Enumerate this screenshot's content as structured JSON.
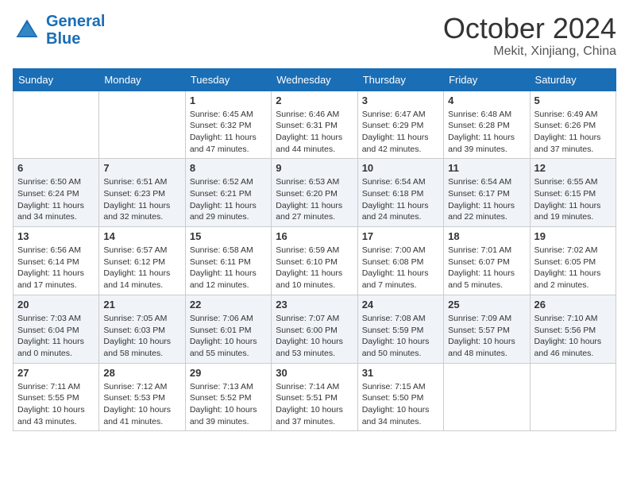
{
  "header": {
    "logo_line1": "General",
    "logo_line2": "Blue",
    "month": "October 2024",
    "location": "Mekit, Xinjiang, China"
  },
  "days_of_week": [
    "Sunday",
    "Monday",
    "Tuesday",
    "Wednesday",
    "Thursday",
    "Friday",
    "Saturday"
  ],
  "weeks": [
    [
      {
        "day": "",
        "info": ""
      },
      {
        "day": "",
        "info": ""
      },
      {
        "day": "1",
        "info": "Sunrise: 6:45 AM\nSunset: 6:32 PM\nDaylight: 11 hours and 47 minutes."
      },
      {
        "day": "2",
        "info": "Sunrise: 6:46 AM\nSunset: 6:31 PM\nDaylight: 11 hours and 44 minutes."
      },
      {
        "day": "3",
        "info": "Sunrise: 6:47 AM\nSunset: 6:29 PM\nDaylight: 11 hours and 42 minutes."
      },
      {
        "day": "4",
        "info": "Sunrise: 6:48 AM\nSunset: 6:28 PM\nDaylight: 11 hours and 39 minutes."
      },
      {
        "day": "5",
        "info": "Sunrise: 6:49 AM\nSunset: 6:26 PM\nDaylight: 11 hours and 37 minutes."
      }
    ],
    [
      {
        "day": "6",
        "info": "Sunrise: 6:50 AM\nSunset: 6:24 PM\nDaylight: 11 hours and 34 minutes."
      },
      {
        "day": "7",
        "info": "Sunrise: 6:51 AM\nSunset: 6:23 PM\nDaylight: 11 hours and 32 minutes."
      },
      {
        "day": "8",
        "info": "Sunrise: 6:52 AM\nSunset: 6:21 PM\nDaylight: 11 hours and 29 minutes."
      },
      {
        "day": "9",
        "info": "Sunrise: 6:53 AM\nSunset: 6:20 PM\nDaylight: 11 hours and 27 minutes."
      },
      {
        "day": "10",
        "info": "Sunrise: 6:54 AM\nSunset: 6:18 PM\nDaylight: 11 hours and 24 minutes."
      },
      {
        "day": "11",
        "info": "Sunrise: 6:54 AM\nSunset: 6:17 PM\nDaylight: 11 hours and 22 minutes."
      },
      {
        "day": "12",
        "info": "Sunrise: 6:55 AM\nSunset: 6:15 PM\nDaylight: 11 hours and 19 minutes."
      }
    ],
    [
      {
        "day": "13",
        "info": "Sunrise: 6:56 AM\nSunset: 6:14 PM\nDaylight: 11 hours and 17 minutes."
      },
      {
        "day": "14",
        "info": "Sunrise: 6:57 AM\nSunset: 6:12 PM\nDaylight: 11 hours and 14 minutes."
      },
      {
        "day": "15",
        "info": "Sunrise: 6:58 AM\nSunset: 6:11 PM\nDaylight: 11 hours and 12 minutes."
      },
      {
        "day": "16",
        "info": "Sunrise: 6:59 AM\nSunset: 6:10 PM\nDaylight: 11 hours and 10 minutes."
      },
      {
        "day": "17",
        "info": "Sunrise: 7:00 AM\nSunset: 6:08 PM\nDaylight: 11 hours and 7 minutes."
      },
      {
        "day": "18",
        "info": "Sunrise: 7:01 AM\nSunset: 6:07 PM\nDaylight: 11 hours and 5 minutes."
      },
      {
        "day": "19",
        "info": "Sunrise: 7:02 AM\nSunset: 6:05 PM\nDaylight: 11 hours and 2 minutes."
      }
    ],
    [
      {
        "day": "20",
        "info": "Sunrise: 7:03 AM\nSunset: 6:04 PM\nDaylight: 11 hours and 0 minutes."
      },
      {
        "day": "21",
        "info": "Sunrise: 7:05 AM\nSunset: 6:03 PM\nDaylight: 10 hours and 58 minutes."
      },
      {
        "day": "22",
        "info": "Sunrise: 7:06 AM\nSunset: 6:01 PM\nDaylight: 10 hours and 55 minutes."
      },
      {
        "day": "23",
        "info": "Sunrise: 7:07 AM\nSunset: 6:00 PM\nDaylight: 10 hours and 53 minutes."
      },
      {
        "day": "24",
        "info": "Sunrise: 7:08 AM\nSunset: 5:59 PM\nDaylight: 10 hours and 50 minutes."
      },
      {
        "day": "25",
        "info": "Sunrise: 7:09 AM\nSunset: 5:57 PM\nDaylight: 10 hours and 48 minutes."
      },
      {
        "day": "26",
        "info": "Sunrise: 7:10 AM\nSunset: 5:56 PM\nDaylight: 10 hours and 46 minutes."
      }
    ],
    [
      {
        "day": "27",
        "info": "Sunrise: 7:11 AM\nSunset: 5:55 PM\nDaylight: 10 hours and 43 minutes."
      },
      {
        "day": "28",
        "info": "Sunrise: 7:12 AM\nSunset: 5:53 PM\nDaylight: 10 hours and 41 minutes."
      },
      {
        "day": "29",
        "info": "Sunrise: 7:13 AM\nSunset: 5:52 PM\nDaylight: 10 hours and 39 minutes."
      },
      {
        "day": "30",
        "info": "Sunrise: 7:14 AM\nSunset: 5:51 PM\nDaylight: 10 hours and 37 minutes."
      },
      {
        "day": "31",
        "info": "Sunrise: 7:15 AM\nSunset: 5:50 PM\nDaylight: 10 hours and 34 minutes."
      },
      {
        "day": "",
        "info": ""
      },
      {
        "day": "",
        "info": ""
      }
    ]
  ]
}
